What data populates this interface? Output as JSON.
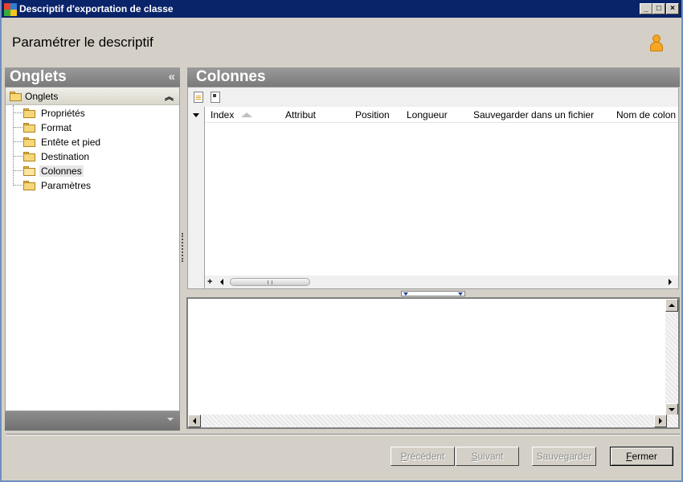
{
  "window": {
    "title": "Descriptif d'exportation de classe",
    "minimize_glyph": "_",
    "maximize_glyph": "□",
    "close_glyph": "×"
  },
  "header": {
    "title": "Paramétrer le descriptif",
    "user_icon": "user-icon"
  },
  "left_panel": {
    "title": "Onglets",
    "collapse_glyph": "«",
    "tree": {
      "root_label": "Onglets",
      "root_chevron": "⌃",
      "items": [
        {
          "label": "Propriétés",
          "selected": false
        },
        {
          "label": "Format",
          "selected": false
        },
        {
          "label": "Entête et pied",
          "selected": false
        },
        {
          "label": "Destination",
          "selected": false
        },
        {
          "label": "Colonnes",
          "selected": true
        },
        {
          "label": "Paramètres",
          "selected": false
        }
      ]
    }
  },
  "right_panel": {
    "title": "Colonnes",
    "toolbar": {
      "icons": [
        "new-document-icon",
        "edit-document-icon"
      ]
    },
    "grid": {
      "columns": [
        "Index",
        "Attribut",
        "Position",
        "Longueur",
        "Sauvegarder dans un fichier",
        "Nom de colon"
      ],
      "sorted_column": "Index",
      "rows": [],
      "add_glyph": "+"
    }
  },
  "buttons": {
    "previous": {
      "label_prefix": "",
      "label_accel": "P",
      "label_rest": "récédent",
      "enabled": false
    },
    "next": {
      "label_prefix": "",
      "label_accel": "S",
      "label_rest": "uivant",
      "enabled": false
    },
    "save": {
      "label": "Sauvegarder",
      "enabled": false
    },
    "close": {
      "label_prefix": "",
      "label_accel": "F",
      "label_rest": "ermer",
      "enabled": true
    }
  },
  "colors": {
    "titlebar": "#0a246a",
    "panel_header": "#808080",
    "window_bg": "#d4d0c8"
  }
}
